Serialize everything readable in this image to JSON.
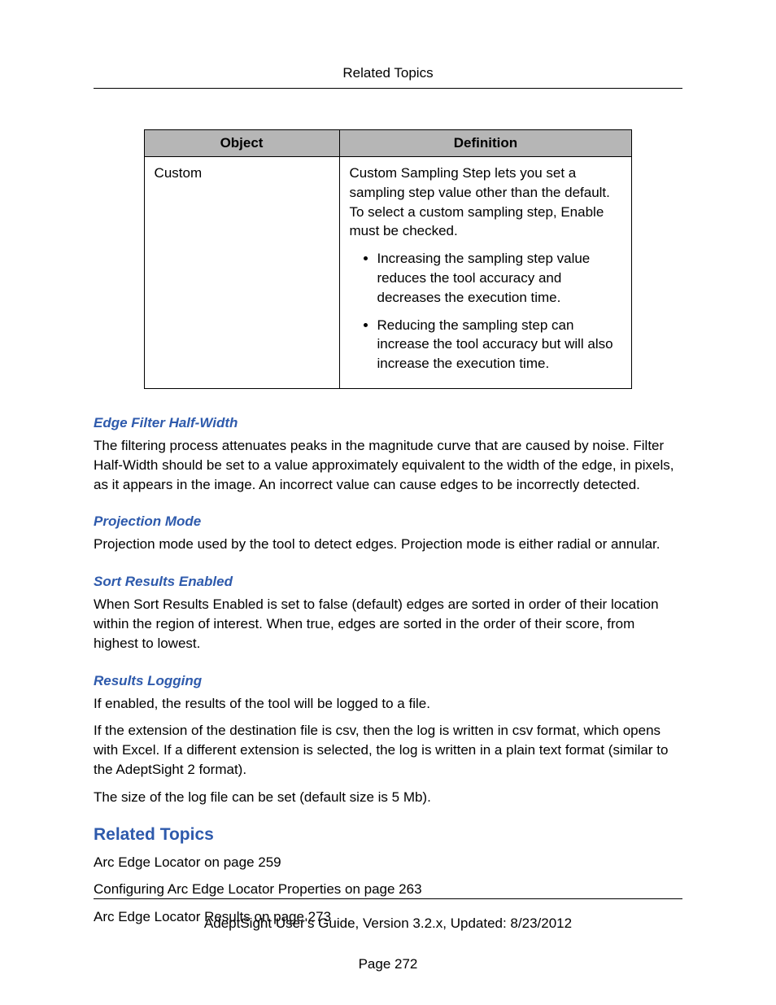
{
  "header": {
    "title": "Related Topics"
  },
  "table": {
    "headers": {
      "object": "Object",
      "definition": "Definition"
    },
    "row": {
      "object": "Custom",
      "intro": "Custom Sampling Step lets you set a sampling step value other than the default. To select a custom sampling step, Enable must be checked.",
      "bullets": [
        "Increasing the sampling step value reduces the tool accuracy and decreases the execution time.",
        "Reducing the sampling step can increase the tool accuracy but will also increase the execution time."
      ]
    }
  },
  "sections": {
    "edgeFilter": {
      "heading": "Edge Filter Half-Width",
      "body": "The filtering process attenuates peaks in the magnitude curve that are caused by noise. Filter Half-Width should be set to a value approximately equivalent to the width of the edge, in pixels, as it appears in the image. An incorrect value can cause edges to be incorrectly detected."
    },
    "projection": {
      "heading": "Projection Mode",
      "body": "Projection mode used by the tool to detect edges. Projection mode is either radial or annular."
    },
    "sort": {
      "heading": "Sort Results Enabled",
      "body": "When Sort Results Enabled is set to false (default) edges are sorted in order of their location within the region of interest. When true, edges are sorted in the order of their score, from highest to lowest."
    },
    "logging": {
      "heading": "Results Logging",
      "p1": "If enabled, the results of the tool will be logged to a file.",
      "p2": "If the extension of the destination file is csv, then the log is written in csv format, which opens with Excel. If a different extension is selected, the log is written in a plain text format (similar to the AdeptSight 2 format).",
      "p3": "The size of the log file can be set (default size is 5 Mb)."
    }
  },
  "related": {
    "heading": "Related Topics",
    "items": [
      "Arc Edge Locator on page 259",
      "Configuring Arc Edge Locator Properties on page 263",
      "Arc Edge Locator Results on page 273"
    ]
  },
  "footer": {
    "line1": "AdeptSight User's Guide,  Version 3.2.x, Updated: 8/23/2012",
    "line2": "Page 272"
  }
}
